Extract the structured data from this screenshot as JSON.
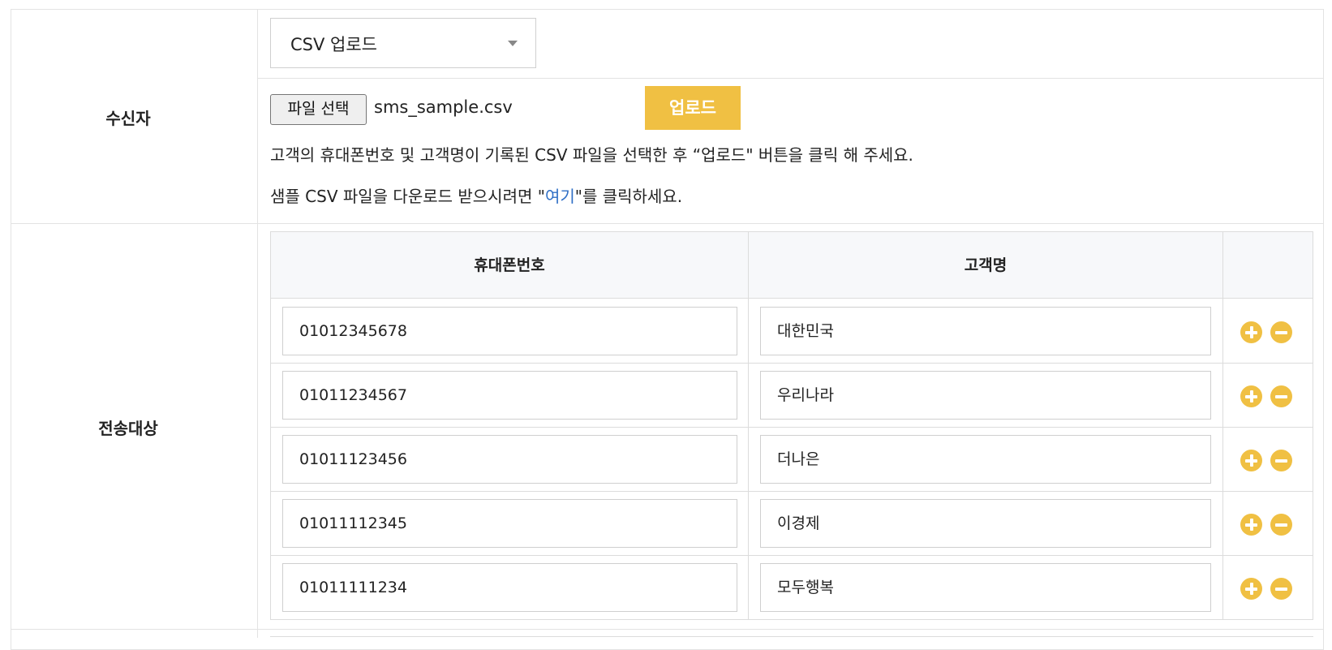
{
  "recipient": {
    "label": "수신자",
    "select_value": "CSV 업로드",
    "file_button": "파일 선택",
    "file_name": "sms_sample.csv",
    "upload_button": "업로드",
    "help_text": "고객의 휴대폰번호 및 고객명이 기록된 CSV 파일을 선택한 후 “업로드\" 버튼을 클릭 해 주세요.",
    "sample_prefix": "샘플 CSV 파일을 다운로드 받으시려면 \"",
    "sample_link": "여기",
    "sample_suffix": "\"를 클릭하세요."
  },
  "targets": {
    "label": "전송대상",
    "columns": [
      "휴대폰번호",
      "고객명"
    ],
    "rows": [
      {
        "phone": "01012345678",
        "name": "대한민국"
      },
      {
        "phone": "01011234567",
        "name": "우리나라"
      },
      {
        "phone": "01011123456",
        "name": "더나은"
      },
      {
        "phone": "01011112345",
        "name": "이경제"
      },
      {
        "phone": "01011111234",
        "name": "모두행복"
      }
    ],
    "icons": {
      "add": "plus-circle-icon",
      "remove": "minus-circle-icon"
    }
  },
  "colors": {
    "accent": "#f0c043",
    "link": "#2f6fc6",
    "border": "#e3e3e3",
    "header_bg": "#f7f8fa"
  }
}
